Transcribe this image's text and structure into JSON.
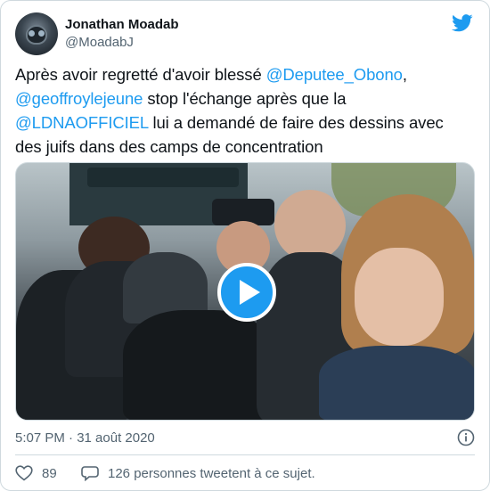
{
  "author": {
    "name": "Jonathan Moadab",
    "handle": "@MoadabJ"
  },
  "tweet": {
    "segments": [
      {
        "text": "Après avoir regretté d'avoir blessé ",
        "mention": false
      },
      {
        "text": "@Deputee_Obono",
        "mention": true
      },
      {
        "text": ", ",
        "mention": false
      },
      {
        "text": "@geoffroylejeune",
        "mention": true
      },
      {
        "text": " stop l'échange après que la ",
        "mention": false
      },
      {
        "text": "@LDNAOFFICIEL",
        "mention": true
      },
      {
        "text": " lui a demandé de faire des dessins avec des juifs dans des camps de concentration",
        "mention": false
      }
    ],
    "timestamp": "5:07 PM · 31 août 2020"
  },
  "media": {
    "kind": "video",
    "play_icon": "play-icon"
  },
  "actions": {
    "likes": "89",
    "retweet_text": "126 personnes tweetent à ce sujet."
  },
  "icons": {
    "brand": "twitter-bird-icon",
    "info": "info-icon",
    "like": "heart-icon",
    "reply": "speech-bubble-icon"
  },
  "colors": {
    "accent": "#1d9bf0",
    "text": "#0f1419",
    "muted": "#536471",
    "border": "#cfd9de"
  }
}
